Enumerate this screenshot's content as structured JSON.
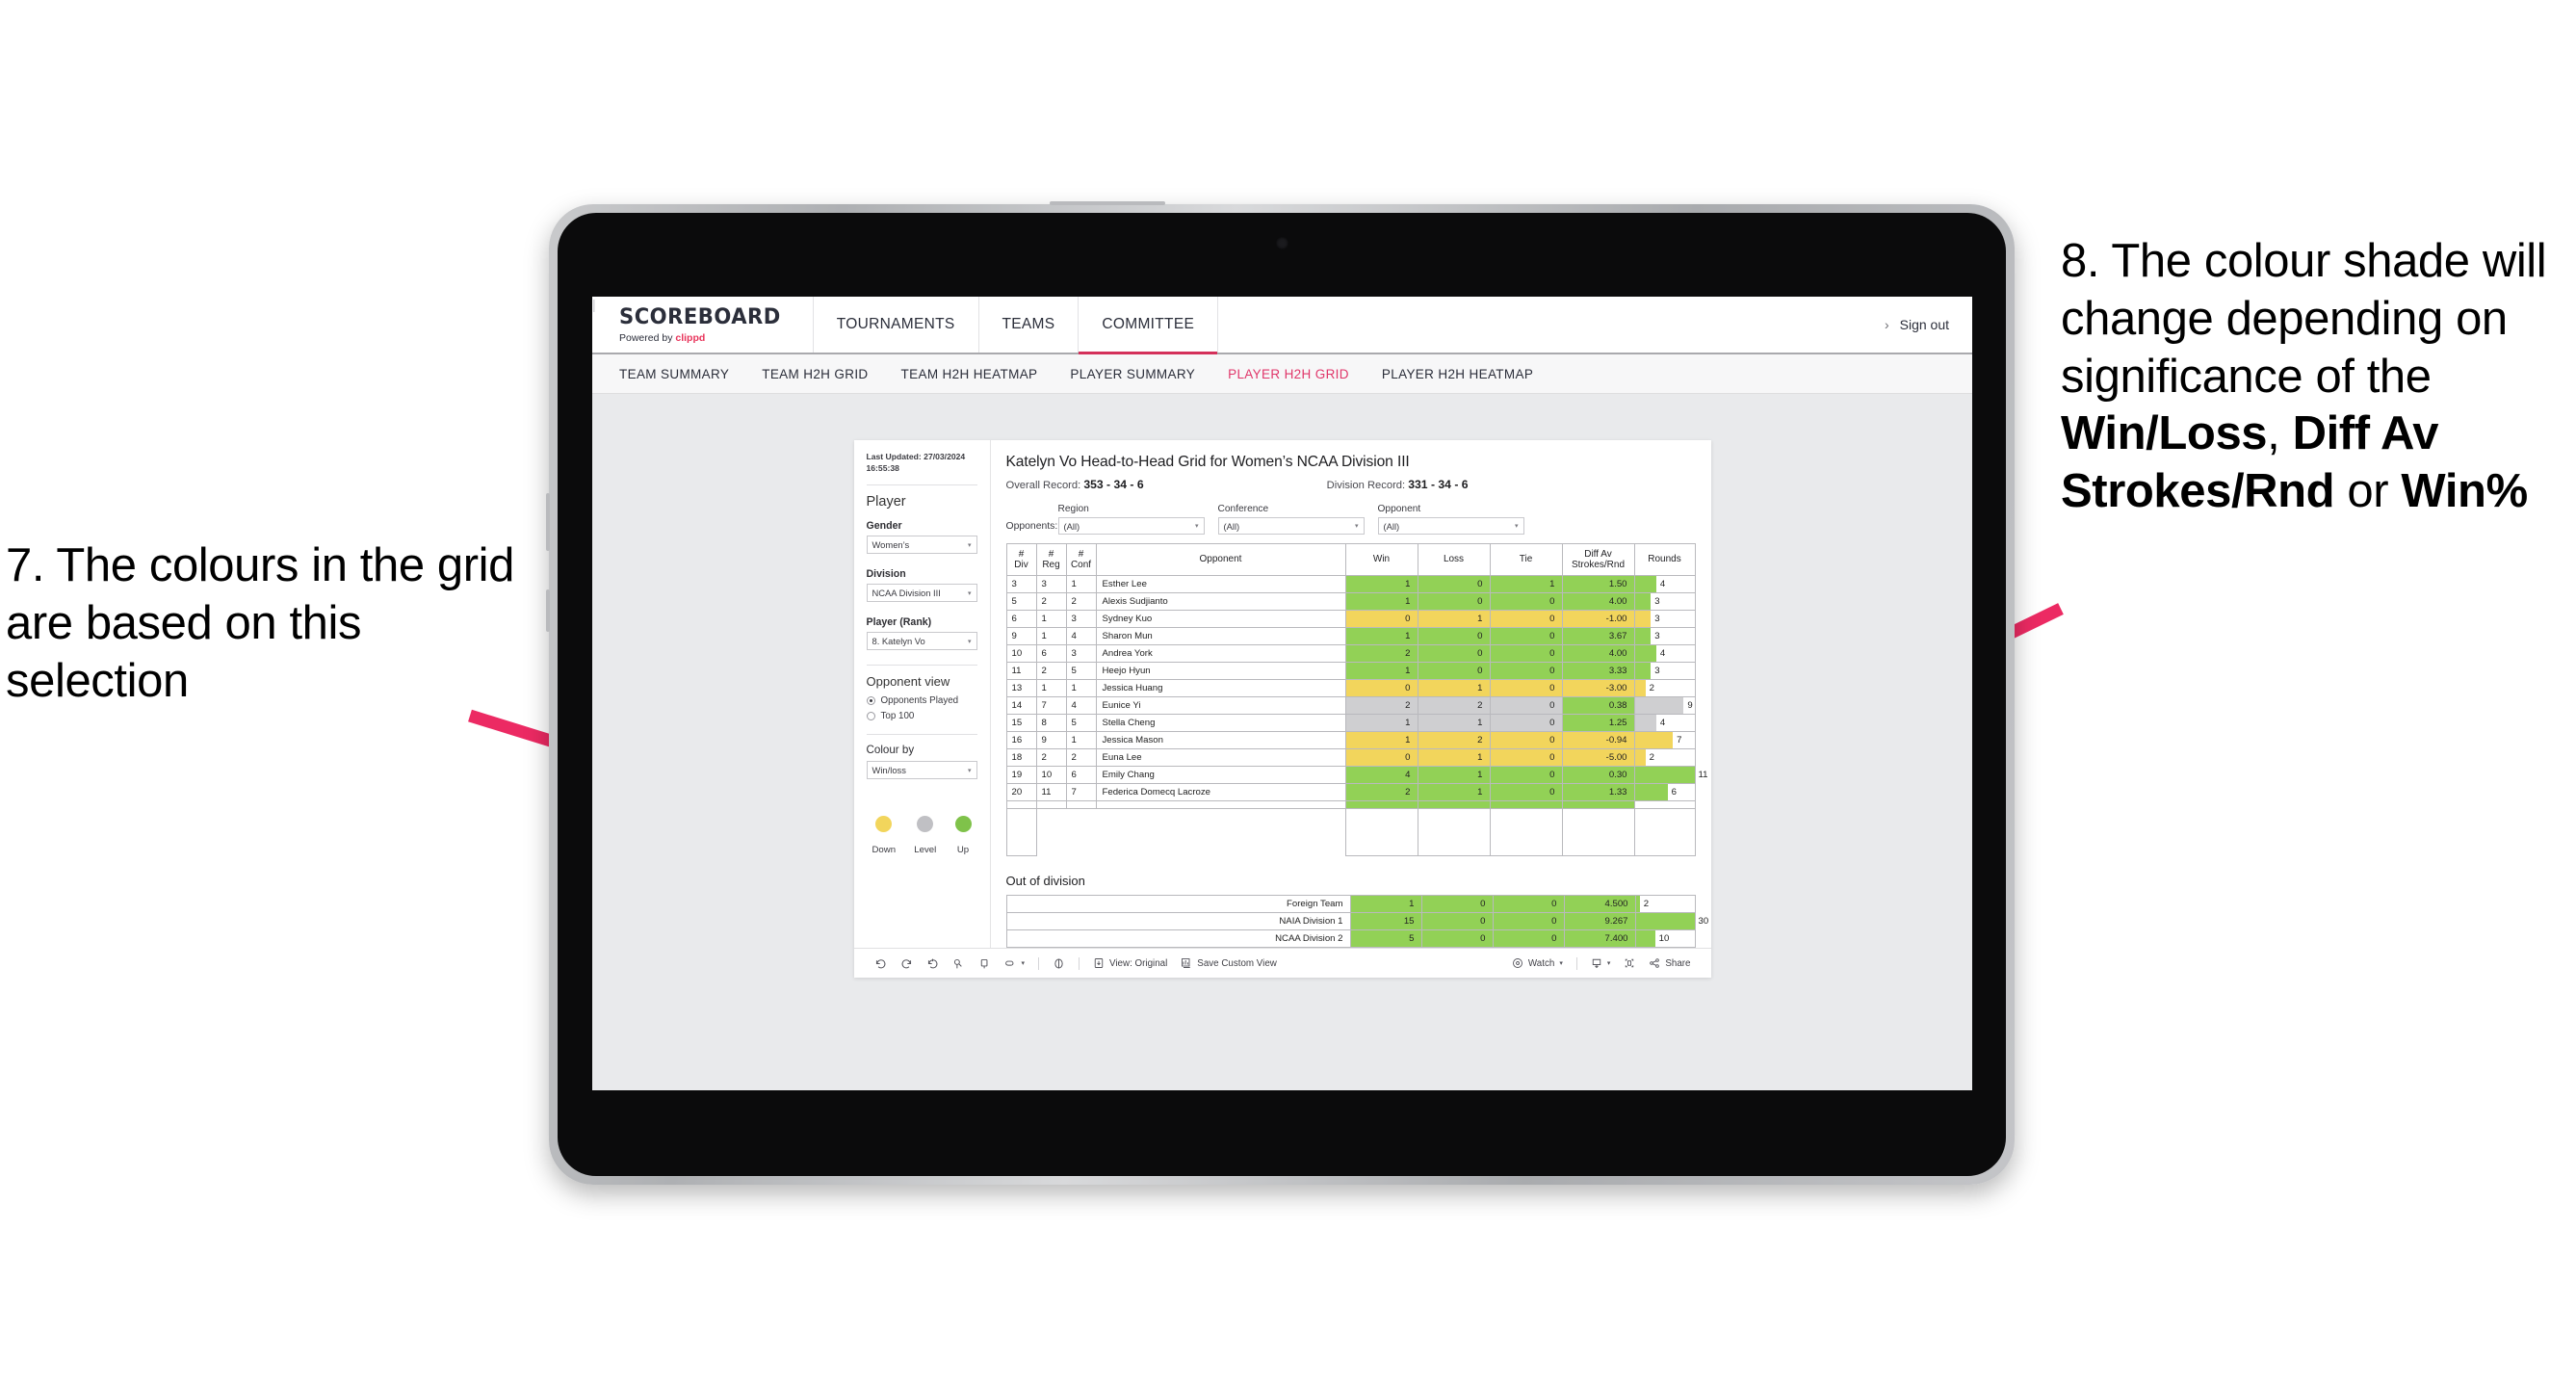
{
  "annotations": {
    "left": "7. The colours in the grid are based on this selection",
    "right_pre": "8. The colour shade will change depending on significance of the ",
    "right_b1": "Win/Loss",
    "right_mid1": ", ",
    "right_b2": "Diff Av Strokes/Rnd",
    "right_mid2": " or ",
    "right_b3": "Win%",
    "arrow_color": "#ec2a63"
  },
  "header": {
    "brand_title": "SCOREBOARD",
    "brand_powered": "Powered by ",
    "brand_name": "clippd",
    "nav": [
      {
        "label": "TOURNAMENTS",
        "active": false
      },
      {
        "label": "TEAMS",
        "active": false
      },
      {
        "label": "COMMITTEE",
        "active": true
      }
    ],
    "chevron": "›",
    "divider": "|",
    "signout": "Sign out"
  },
  "subnav": [
    {
      "label": "TEAM SUMMARY",
      "active": false
    },
    {
      "label": "TEAM H2H GRID",
      "active": false
    },
    {
      "label": "TEAM H2H HEATMAP",
      "active": false
    },
    {
      "label": "PLAYER SUMMARY",
      "active": false
    },
    {
      "label": "PLAYER H2H GRID",
      "active": true
    },
    {
      "label": "PLAYER H2H HEATMAP",
      "active": false
    }
  ],
  "panel": {
    "last_updated": "Last Updated: 27/03/2024 16:55:38",
    "player_title": "Player",
    "gender_label": "Gender",
    "gender_value": "Women’s",
    "division_label": "Division",
    "division_value": "NCAA Division III",
    "player_rank_label": "Player (Rank)",
    "player_rank_value": "8. Katelyn Vo",
    "opponent_view_title": "Opponent view",
    "opponent_options": [
      {
        "label": "Opponents Played",
        "selected": true
      },
      {
        "label": "Top 100",
        "selected": false
      }
    ],
    "colour_by_label": "Colour by",
    "colour_by_value": "Win/loss",
    "legend": [
      {
        "label": "Down",
        "color": "#f2d55c"
      },
      {
        "label": "Level",
        "color": "#c0c0c4"
      },
      {
        "label": "Up",
        "color": "#7fc24a"
      }
    ],
    "caret": "▾"
  },
  "main": {
    "title": "Katelyn Vo Head-to-Head Grid for Women’s NCAA Division III",
    "overall_record_label": "Overall Record: ",
    "overall_record_value": "353 - 34 - 6",
    "division_record_label": "Division Record: ",
    "division_record_value": "331 - 34 - 6",
    "opponents_label": "Opponents:",
    "filters": [
      {
        "label": "Region",
        "value": "(All)"
      },
      {
        "label": "Conference",
        "value": "(All)"
      },
      {
        "label": "Opponent",
        "value": "(All)"
      }
    ],
    "out_of_division_title": "Out of division"
  },
  "chart_data": {
    "type": "table",
    "title": "Katelyn Vo Head-to-Head Grid for Women’s NCAA Division III",
    "columns": [
      "# Div",
      "# Reg",
      "# Conf",
      "Opponent",
      "Win",
      "Loss",
      "Tie",
      "Diff Av Strokes/Rnd",
      "Rounds"
    ],
    "column_headers_multiline": [
      [
        "#",
        "Div"
      ],
      [
        "#",
        "Reg"
      ],
      [
        "#",
        "Conf"
      ],
      [
        "Opponent"
      ],
      [
        "Win"
      ],
      [
        "Loss"
      ],
      [
        "Tie"
      ],
      [
        "Diff Av",
        "Strokes/Rnd"
      ],
      [
        "Rounds"
      ]
    ],
    "rounds_max": 11,
    "rows": [
      {
        "div": "3",
        "reg": "3",
        "conf": "1",
        "opponent": "Esther Lee",
        "win": "1",
        "loss": "0",
        "tie": "1",
        "diff": "1.50",
        "rounds": "4",
        "rounds_n": 4,
        "color": "green"
      },
      {
        "div": "5",
        "reg": "2",
        "conf": "2",
        "opponent": "Alexis Sudjianto",
        "win": "1",
        "loss": "0",
        "tie": "0",
        "diff": "4.00",
        "rounds": "3",
        "rounds_n": 3,
        "color": "green"
      },
      {
        "div": "6",
        "reg": "1",
        "conf": "3",
        "opponent": "Sydney Kuo",
        "win": "0",
        "loss": "1",
        "tie": "0",
        "diff": "-1.00",
        "rounds": "3",
        "rounds_n": 3,
        "color": "yellow"
      },
      {
        "div": "9",
        "reg": "1",
        "conf": "4",
        "opponent": "Sharon Mun",
        "win": "1",
        "loss": "0",
        "tie": "0",
        "diff": "3.67",
        "rounds": "3",
        "rounds_n": 3,
        "color": "green"
      },
      {
        "div": "10",
        "reg": "6",
        "conf": "3",
        "opponent": "Andrea York",
        "win": "2",
        "loss": "0",
        "tie": "0",
        "diff": "4.00",
        "rounds": "4",
        "rounds_n": 4,
        "color": "green"
      },
      {
        "div": "11",
        "reg": "2",
        "conf": "5",
        "opponent": "Heejo Hyun",
        "win": "1",
        "loss": "0",
        "tie": "0",
        "diff": "3.33",
        "rounds": "3",
        "rounds_n": 3,
        "color": "green"
      },
      {
        "div": "13",
        "reg": "1",
        "conf": "1",
        "opponent": "Jessica Huang",
        "win": "0",
        "loss": "1",
        "tie": "0",
        "diff": "-3.00",
        "rounds": "2",
        "rounds_n": 2,
        "color": "yellow"
      },
      {
        "div": "14",
        "reg": "7",
        "conf": "4",
        "opponent": "Eunice Yi",
        "win": "2",
        "loss": "2",
        "tie": "0",
        "diff": "0.38",
        "rounds": "9",
        "rounds_n": 9,
        "color": "gray",
        "diff_color": "green"
      },
      {
        "div": "15",
        "reg": "8",
        "conf": "5",
        "opponent": "Stella Cheng",
        "win": "1",
        "loss": "1",
        "tie": "0",
        "diff": "1.25",
        "rounds": "4",
        "rounds_n": 4,
        "color": "gray",
        "diff_color": "green"
      },
      {
        "div": "16",
        "reg": "9",
        "conf": "1",
        "opponent": "Jessica Mason",
        "win": "1",
        "loss": "2",
        "tie": "0",
        "diff": "-0.94",
        "rounds": "7",
        "rounds_n": 7,
        "color": "yellow"
      },
      {
        "div": "18",
        "reg": "2",
        "conf": "2",
        "opponent": "Euna Lee",
        "win": "0",
        "loss": "1",
        "tie": "0",
        "diff": "-5.00",
        "rounds": "2",
        "rounds_n": 2,
        "color": "yellow"
      },
      {
        "div": "19",
        "reg": "10",
        "conf": "6",
        "opponent": "Emily Chang",
        "win": "4",
        "loss": "1",
        "tie": "0",
        "diff": "0.30",
        "rounds": "11",
        "rounds_n": 11,
        "color": "green"
      },
      {
        "div": "20",
        "reg": "11",
        "conf": "7",
        "opponent": "Federica Domecq Lacroze",
        "win": "2",
        "loss": "1",
        "tie": "0",
        "diff": "1.33",
        "rounds": "6",
        "rounds_n": 6,
        "color": "green"
      }
    ],
    "out_of_division": {
      "rounds_max": 30,
      "rows": [
        {
          "name": "Foreign Team",
          "win": "1",
          "loss": "0",
          "tie": "0",
          "diff": "4.500",
          "rounds": "2",
          "rounds_n": 2,
          "color": "green"
        },
        {
          "name": "NAIA Division 1",
          "win": "15",
          "loss": "0",
          "tie": "0",
          "diff": "9.267",
          "rounds": "30",
          "rounds_n": 30,
          "color": "green"
        },
        {
          "name": "NCAA Division 2",
          "win": "5",
          "loss": "0",
          "tie": "0",
          "diff": "7.400",
          "rounds": "10",
          "rounds_n": 10,
          "color": "green"
        }
      ]
    }
  },
  "toolbar": {
    "view_label": "View: Original",
    "save_label": "Save Custom View",
    "watch_label": "Watch",
    "share_label": "Share",
    "caret": "▾"
  }
}
